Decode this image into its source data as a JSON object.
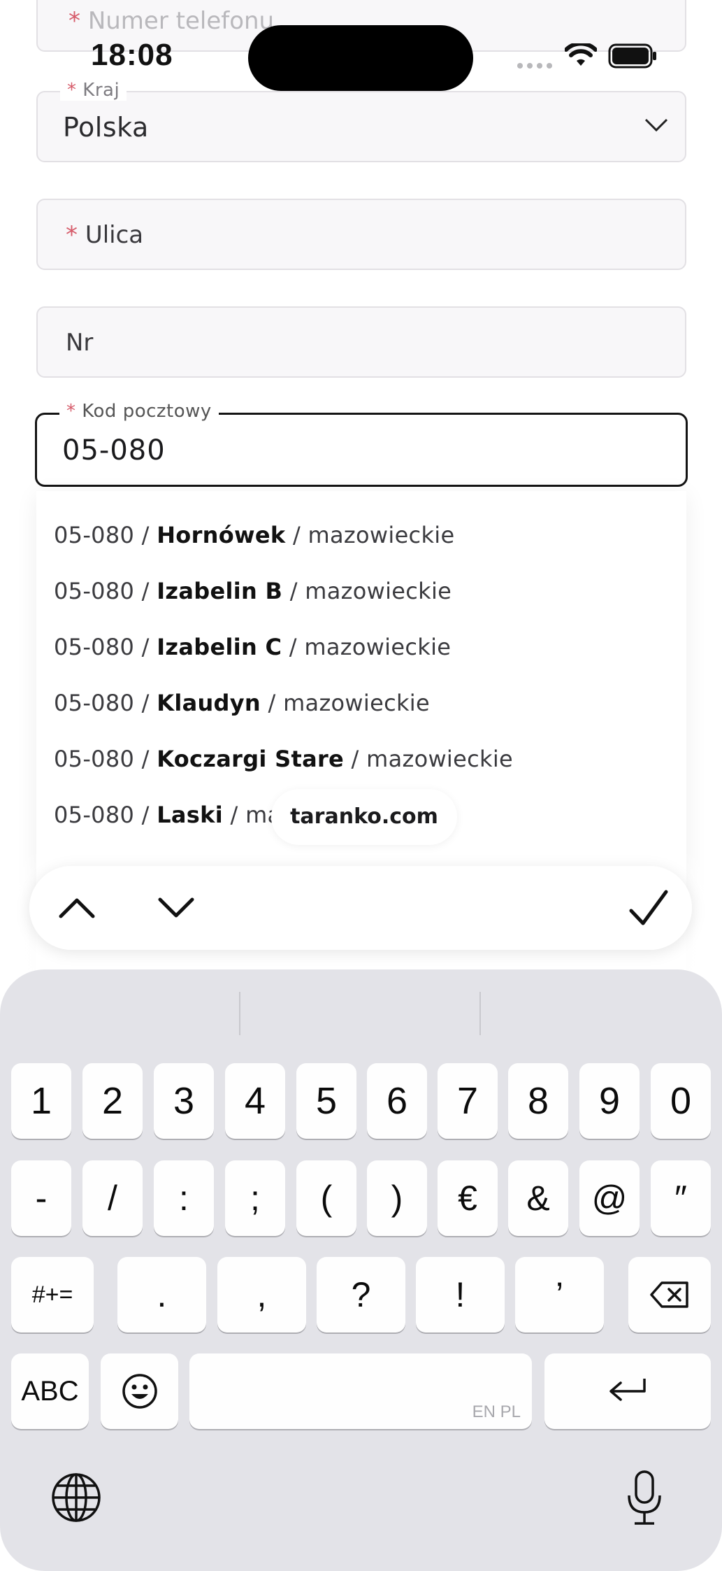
{
  "status_bar": {
    "time": "18:08"
  },
  "form": {
    "phone": {
      "label": "Numer telefonu",
      "required": "*"
    },
    "country": {
      "label": "Kraj",
      "required": "*",
      "value": "Polska"
    },
    "street": {
      "placeholder": "Ulica",
      "required": "*"
    },
    "number": {
      "placeholder": "Nr"
    },
    "postal": {
      "label": "Kod pocztowy",
      "required": "*",
      "value": "05-080"
    }
  },
  "suggestions": [
    {
      "code": "05-080",
      "city": "Hornówek",
      "region": "mazowieckie"
    },
    {
      "code": "05-080",
      "city": "Izabelin B",
      "region": "mazowieckie"
    },
    {
      "code": "05-080",
      "city": "Izabelin C",
      "region": "mazowieckie"
    },
    {
      "code": "05-080",
      "city": "Klaudyn",
      "region": "mazowieckie"
    },
    {
      "code": "05-080",
      "city": "Koczargi Stare",
      "region": "mazowieckie"
    },
    {
      "code": "05-080",
      "city": "Laski",
      "region": "mazowieckie"
    }
  ],
  "separator": "/",
  "browser": {
    "url": "taranko.com"
  },
  "keyboard": {
    "row1": [
      "1",
      "2",
      "3",
      "4",
      "5",
      "6",
      "7",
      "8",
      "9",
      "0"
    ],
    "row2": [
      "-",
      "/",
      ":",
      ";",
      "(",
      ")",
      "€",
      "&",
      "@",
      "″"
    ],
    "row3": [
      "#+=",
      ".",
      ",",
      "?",
      "!",
      "’"
    ],
    "abc": "ABC",
    "space_hint": "EN PL"
  },
  "colors": {
    "required": "#d65b6a",
    "keyboard_bg": "#e3e3e8",
    "key_bg": "#fefefe"
  },
  "icons": [
    "wifi-icon",
    "battery-icon",
    "chevron-down-icon",
    "chevron-up-icon",
    "checkmark-icon",
    "backspace-icon",
    "emoji-icon",
    "return-icon",
    "globe-icon",
    "microphone-icon"
  ]
}
